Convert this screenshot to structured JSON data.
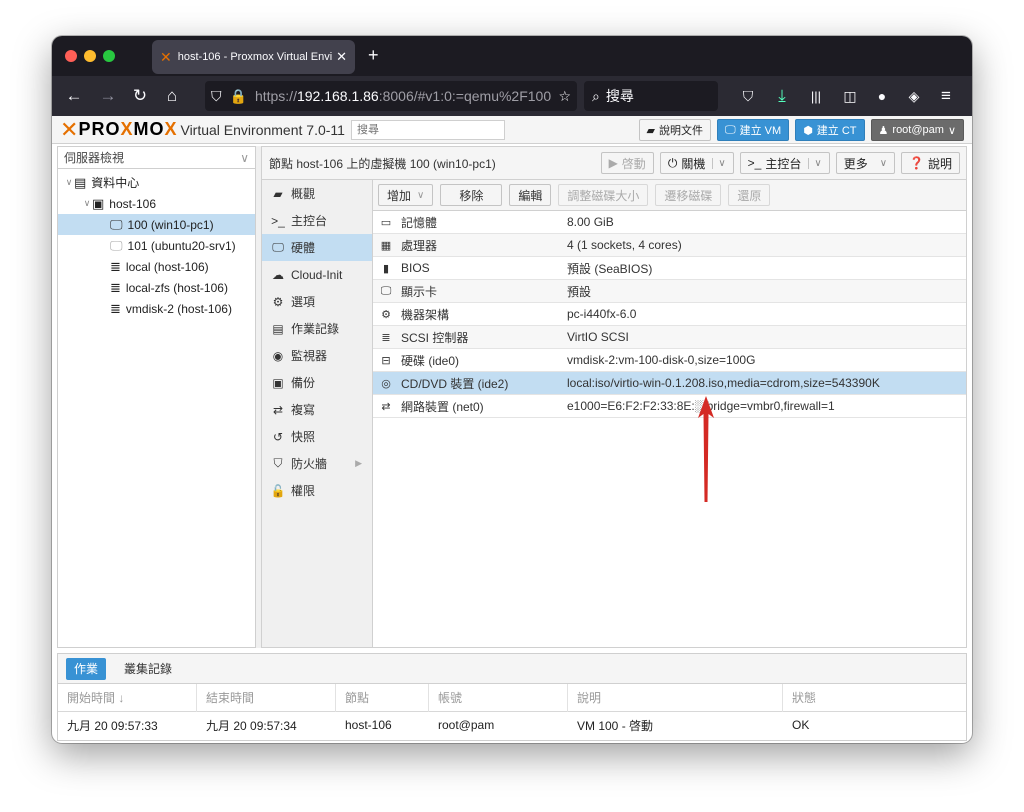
{
  "browser": {
    "tab_title": "host-106 - Proxmox Virtual Envir",
    "url_prefix": "https://",
    "url_host": "192.168.1.86",
    "url_rest": ":8006/#v1:0:=qemu%2F100",
    "search_placeholder": "搜尋"
  },
  "header": {
    "version": "Virtual Environment 7.0-11",
    "search_placeholder": "搜尋",
    "docs_label": "說明文件",
    "create_vm_label": "建立 VM",
    "create_ct_label": "建立 CT",
    "user_label": "root@pam"
  },
  "sidebar": {
    "view_label": "伺服器檢視",
    "tree": [
      {
        "label": "資料中心",
        "indent": 0,
        "icon": "datacenter-icon",
        "expand": "∨"
      },
      {
        "label": "host-106",
        "indent": 1,
        "icon": "node-icon",
        "expand": "∨"
      },
      {
        "label": "100 (win10-pc1)",
        "indent": 2,
        "icon": "vm-running-icon",
        "expand": "",
        "selected": true
      },
      {
        "label": "101 (ubuntu20-srv1)",
        "indent": 2,
        "icon": "vm-stopped-icon",
        "expand": ""
      },
      {
        "label": "local (host-106)",
        "indent": 2,
        "icon": "storage-icon",
        "expand": ""
      },
      {
        "label": "local-zfs (host-106)",
        "indent": 2,
        "icon": "storage-icon",
        "expand": ""
      },
      {
        "label": "vmdisk-2 (host-106)",
        "indent": 2,
        "icon": "storage-icon",
        "expand": ""
      }
    ]
  },
  "main": {
    "title": "節點 host-106 上的虛擬機 100 (win10-pc1)",
    "actions": {
      "start": "啓動",
      "shutdown": "關機",
      "console": "主控台",
      "more": "更多",
      "help": "說明"
    },
    "nav": [
      {
        "label": "概觀",
        "icon": "book-icon",
        "glyph": "▰"
      },
      {
        "label": "主控台",
        "icon": "terminal-icon",
        "glyph": ">_"
      },
      {
        "label": "硬體",
        "icon": "desktop-icon",
        "glyph": "🖵",
        "selected": true
      },
      {
        "label": "Cloud-Init",
        "icon": "cloud-icon",
        "glyph": "☁"
      },
      {
        "label": "選項",
        "icon": "gear-icon",
        "glyph": "⚙"
      },
      {
        "label": "作業記錄",
        "icon": "list-icon",
        "glyph": "▤"
      },
      {
        "label": "監視器",
        "icon": "eye-icon",
        "glyph": "◉"
      },
      {
        "label": "備份",
        "icon": "floppy-icon",
        "glyph": "▣"
      },
      {
        "label": "複寫",
        "icon": "retweet-icon",
        "glyph": "⇄"
      },
      {
        "label": "快照",
        "icon": "history-icon",
        "glyph": "↺"
      },
      {
        "label": "防火牆",
        "icon": "shield-icon",
        "glyph": "⛉",
        "arrow": true
      },
      {
        "label": "權限",
        "icon": "unlock-icon",
        "glyph": "🔓"
      }
    ],
    "toolbar": {
      "add": "增加",
      "remove": "移除",
      "edit": "編輯",
      "resize": "調整磁碟大小",
      "move": "遷移磁碟",
      "revert": "還原"
    },
    "hardware": [
      {
        "icon": "memory-icon",
        "glyph": "▭",
        "key": "記憶體",
        "value": "8.00 GiB"
      },
      {
        "icon": "cpu-icon",
        "glyph": "▦",
        "key": "處理器",
        "value": "4 (1 sockets, 4 cores)"
      },
      {
        "icon": "chip-icon",
        "glyph": "▮",
        "key": "BIOS",
        "value": "預設 (SeaBIOS)"
      },
      {
        "icon": "display-icon",
        "glyph": "🖵",
        "key": "顯示卡",
        "value": "預設"
      },
      {
        "icon": "cogs-icon",
        "glyph": "⚙",
        "key": "機器架構",
        "value": "pc-i440fx-6.0"
      },
      {
        "icon": "database-icon",
        "glyph": "≣",
        "key": "SCSI 控制器",
        "value": "VirtIO SCSI"
      },
      {
        "icon": "hdd-icon",
        "glyph": "⊟",
        "key": "硬碟 (ide0)",
        "value": "vmdisk-2:vm-100-disk-0,size=100G"
      },
      {
        "icon": "cdrom-icon",
        "glyph": "◎",
        "key": "CD/DVD 裝置 (ide2)",
        "value": "local:iso/virtio-win-0.1.208.iso,media=cdrom,size=543390K",
        "selected": true
      },
      {
        "icon": "network-icon",
        "glyph": "⇄",
        "key": "網路裝置 (net0)",
        "value": "e1000=E6:F2:F2:33:8E:░,bridge=vmbr0,firewall=1"
      }
    ]
  },
  "tasks": {
    "tabs": [
      "作業",
      "叢集記錄"
    ],
    "columns": [
      "開始時間 ↓",
      "結束時間",
      "節點",
      "帳號",
      "說明",
      "狀態"
    ],
    "rows": [
      [
        "九月 20 09:57:33",
        "九月 20 09:57:34",
        "host-106",
        "root@pam",
        "VM 100 - 啓動",
        "OK"
      ]
    ]
  },
  "colors": {
    "accent": "#3892d4",
    "selection": "#c2ddf2",
    "brand": "#e57000",
    "annotation_arrow": "#d42a24"
  }
}
